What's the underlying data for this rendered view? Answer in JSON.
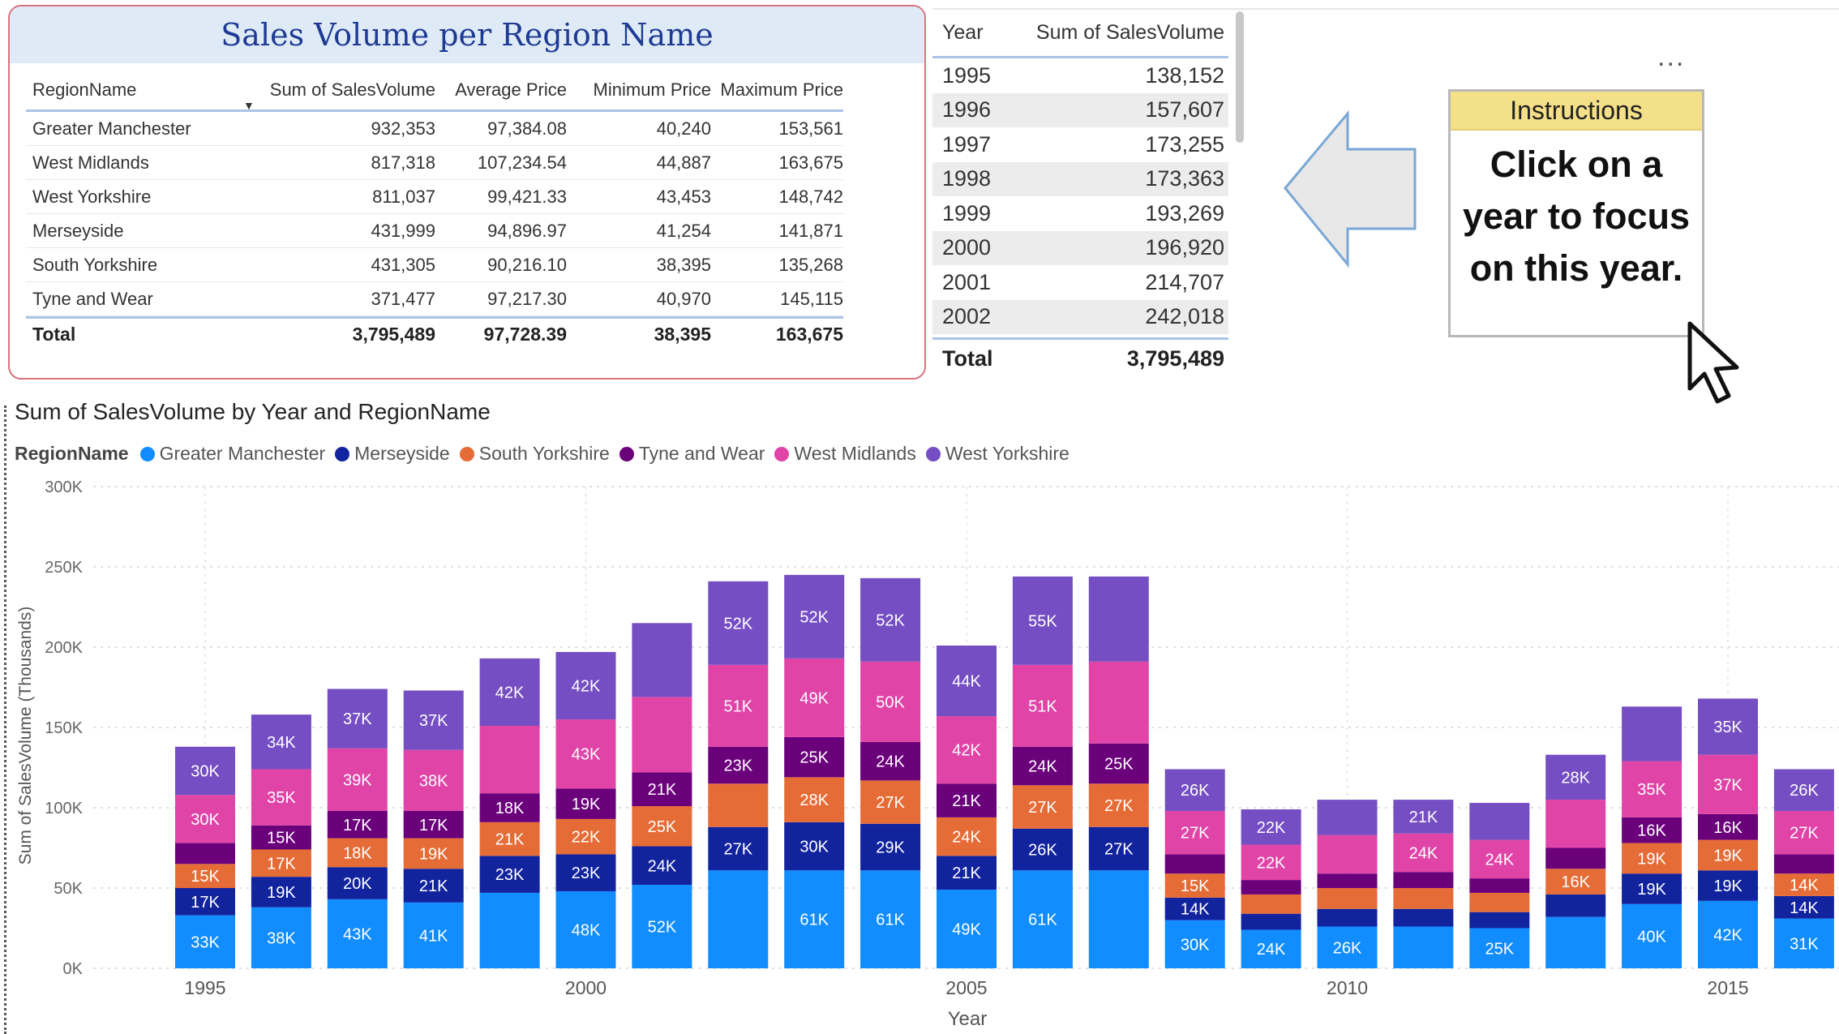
{
  "region_table": {
    "title": "Sales Volume per Region Name",
    "columns": [
      "RegionName",
      "Sum of SalesVolume",
      "Average Price",
      "Minimum Price",
      "Maximum Price"
    ],
    "sort_indicator": "▼",
    "rows": [
      {
        "name": "Greater Manchester",
        "volume": "932,353",
        "avg": "97,384.08",
        "min": "40,240",
        "max": "153,561"
      },
      {
        "name": "West Midlands",
        "volume": "817,318",
        "avg": "107,234.54",
        "min": "44,887",
        "max": "163,675"
      },
      {
        "name": "West Yorkshire",
        "volume": "811,037",
        "avg": "99,421.33",
        "min": "43,453",
        "max": "148,742"
      },
      {
        "name": "Merseyside",
        "volume": "431,999",
        "avg": "94,896.97",
        "min": "41,254",
        "max": "141,871"
      },
      {
        "name": "South Yorkshire",
        "volume": "431,305",
        "avg": "90,216.10",
        "min": "38,395",
        "max": "135,268"
      },
      {
        "name": "Tyne and Wear",
        "volume": "371,477",
        "avg": "97,217.30",
        "min": "40,970",
        "max": "145,115"
      }
    ],
    "total": {
      "label": "Total",
      "volume": "3,795,489",
      "avg": "97,728.39",
      "min": "38,395",
      "max": "163,675"
    }
  },
  "year_table": {
    "columns": [
      "Year",
      "Sum of SalesVolume"
    ],
    "rows": [
      {
        "year": "1995",
        "value": "138,152"
      },
      {
        "year": "1996",
        "value": "157,607"
      },
      {
        "year": "1997",
        "value": "173,255"
      },
      {
        "year": "1998",
        "value": "173,363"
      },
      {
        "year": "1999",
        "value": "193,269"
      },
      {
        "year": "2000",
        "value": "196,920"
      },
      {
        "year": "2001",
        "value": "214,707"
      },
      {
        "year": "2002",
        "value": "242,018"
      }
    ],
    "total": {
      "label": "Total",
      "value": "3,795,489"
    }
  },
  "more_options": "...",
  "instructions": {
    "header": "Instructions",
    "lines": [
      "Click on a",
      "year to focus",
      "on this year."
    ]
  },
  "colors": {
    "Greater Manchester": "#118dff",
    "Merseyside": "#12239e",
    "South Yorkshire": "#e66c37",
    "Tyne and Wear": "#6b007b",
    "West Midlands": "#e044a7",
    "West Yorkshire": "#744ec2"
  },
  "chart_data": {
    "type": "bar",
    "stacked": true,
    "title": "Sum of SalesVolume by Year and RegionName",
    "legend_title": "RegionName",
    "legend": [
      "Greater Manchester",
      "Merseyside",
      "South Yorkshire",
      "Tyne and Wear",
      "West Midlands",
      "West Yorkshire"
    ],
    "xlabel": "Year",
    "ylabel": "Sum of SalesVolume (Thousands)",
    "ylim": [
      0,
      300000
    ],
    "yticks": [
      "0K",
      "50K",
      "100K",
      "150K",
      "200K",
      "250K",
      "300K"
    ],
    "xticks": [
      "1995",
      "2000",
      "2005",
      "2010",
      "2015"
    ],
    "categories": [
      "1995",
      "1996",
      "1997",
      "1998",
      "1999",
      "2000",
      "2001",
      "2002",
      "2003",
      "2004",
      "2005",
      "2006",
      "2007",
      "2008",
      "2009",
      "2010",
      "2011",
      "2012",
      "2013",
      "2014",
      "2015",
      "2016"
    ],
    "series": [
      {
        "name": "Greater Manchester",
        "values": [
          33000,
          38000,
          43000,
          41000,
          47000,
          48000,
          52000,
          61000,
          61000,
          61000,
          49000,
          61000,
          61000,
          30000,
          24000,
          26000,
          26000,
          25000,
          32000,
          40000,
          42000,
          31000
        ],
        "labels": [
          "33K",
          "38K",
          "43K",
          "41K",
          "",
          "48K",
          "52K",
          "",
          "61K",
          "61K",
          "49K",
          "61K",
          "",
          "30K",
          "24K",
          "26K",
          "",
          "25K",
          "",
          "40K",
          "42K",
          "31K"
        ]
      },
      {
        "name": "Merseyside",
        "values": [
          17000,
          19000,
          20000,
          21000,
          23000,
          23000,
          24000,
          27000,
          30000,
          29000,
          21000,
          26000,
          27000,
          14000,
          10000,
          11000,
          11000,
          10000,
          14000,
          19000,
          19000,
          14000
        ],
        "labels": [
          "17K",
          "19K",
          "20K",
          "21K",
          "23K",
          "23K",
          "24K",
          "27K",
          "30K",
          "29K",
          "21K",
          "26K",
          "27K",
          "14K",
          "",
          "",
          "",
          "",
          "",
          "19K",
          "19K",
          "14K"
        ]
      },
      {
        "name": "South Yorkshire",
        "values": [
          15000,
          17000,
          18000,
          19000,
          21000,
          22000,
          25000,
          27000,
          28000,
          27000,
          24000,
          27000,
          27000,
          15000,
          12000,
          13000,
          13000,
          12000,
          16000,
          19000,
          19000,
          14000
        ],
        "labels": [
          "15K",
          "17K",
          "18K",
          "19K",
          "21K",
          "22K",
          "25K",
          "",
          "28K",
          "27K",
          "24K",
          "27K",
          "27K",
          "15K",
          "",
          "",
          "",
          "",
          "16K",
          "19K",
          "19K",
          "14K"
        ]
      },
      {
        "name": "Tyne and Wear",
        "values": [
          13000,
          15000,
          17000,
          17000,
          18000,
          19000,
          21000,
          23000,
          25000,
          24000,
          21000,
          24000,
          25000,
          12000,
          9000,
          9000,
          10000,
          9000,
          13000,
          16000,
          16000,
          12000
        ],
        "labels": [
          "",
          "15K",
          "17K",
          "17K",
          "18K",
          "19K",
          "21K",
          "23K",
          "25K",
          "24K",
          "21K",
          "24K",
          "25K",
          "",
          "",
          "",
          "",
          "",
          "",
          "16K",
          "16K",
          ""
        ]
      },
      {
        "name": "West Midlands",
        "values": [
          30000,
          35000,
          39000,
          38000,
          42000,
          43000,
          47000,
          51000,
          49000,
          50000,
          42000,
          51000,
          51000,
          27000,
          22000,
          24000,
          24000,
          24000,
          30000,
          35000,
          37000,
          27000
        ],
        "labels": [
          "30K",
          "35K",
          "39K",
          "38K",
          "",
          "43K",
          "",
          "51K",
          "49K",
          "50K",
          "42K",
          "51K",
          "",
          "27K",
          "22K",
          "",
          "24K",
          "24K",
          "",
          "35K",
          "37K",
          "27K"
        ]
      },
      {
        "name": "West Yorkshire",
        "values": [
          30000,
          34000,
          37000,
          37000,
          42000,
          42000,
          46000,
          52000,
          52000,
          52000,
          44000,
          55000,
          53000,
          26000,
          22000,
          22000,
          21000,
          23000,
          28000,
          34000,
          35000,
          26000
        ],
        "labels": [
          "30K",
          "34K",
          "37K",
          "37K",
          "42K",
          "42K",
          "",
          "52K",
          "52K",
          "52K",
          "44K",
          "55K",
          "",
          "26K",
          "22K",
          "",
          "21K",
          "",
          "28K",
          "",
          "35K",
          "26K"
        ]
      }
    ]
  }
}
